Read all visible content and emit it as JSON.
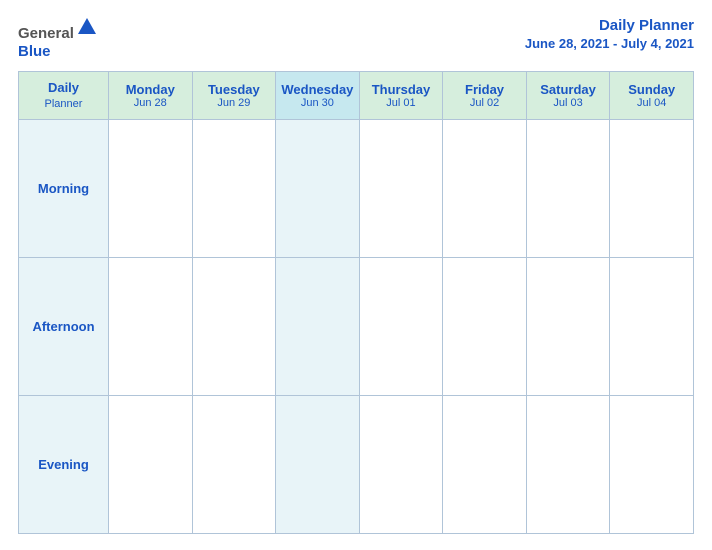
{
  "logo": {
    "general": "General",
    "blue": "Blue"
  },
  "title": {
    "main": "Daily Planner",
    "date_range": "June 28, 2021 - July 4, 2021"
  },
  "header_row": {
    "col0": {
      "name": "Daily",
      "sub": "Planner"
    },
    "col1": {
      "name": "Monday",
      "sub": "Jun 28"
    },
    "col2": {
      "name": "Tuesday",
      "sub": "Jun 29"
    },
    "col3": {
      "name": "Wednesday",
      "sub": "Jun 30"
    },
    "col4": {
      "name": "Thursday",
      "sub": "Jul 01"
    },
    "col5": {
      "name": "Friday",
      "sub": "Jul 02"
    },
    "col6": {
      "name": "Saturday",
      "sub": "Jul 03"
    },
    "col7": {
      "name": "Sunday",
      "sub": "Jul 04"
    }
  },
  "rows": [
    {
      "label": "Morning"
    },
    {
      "label": "Afternoon"
    },
    {
      "label": "Evening"
    }
  ]
}
